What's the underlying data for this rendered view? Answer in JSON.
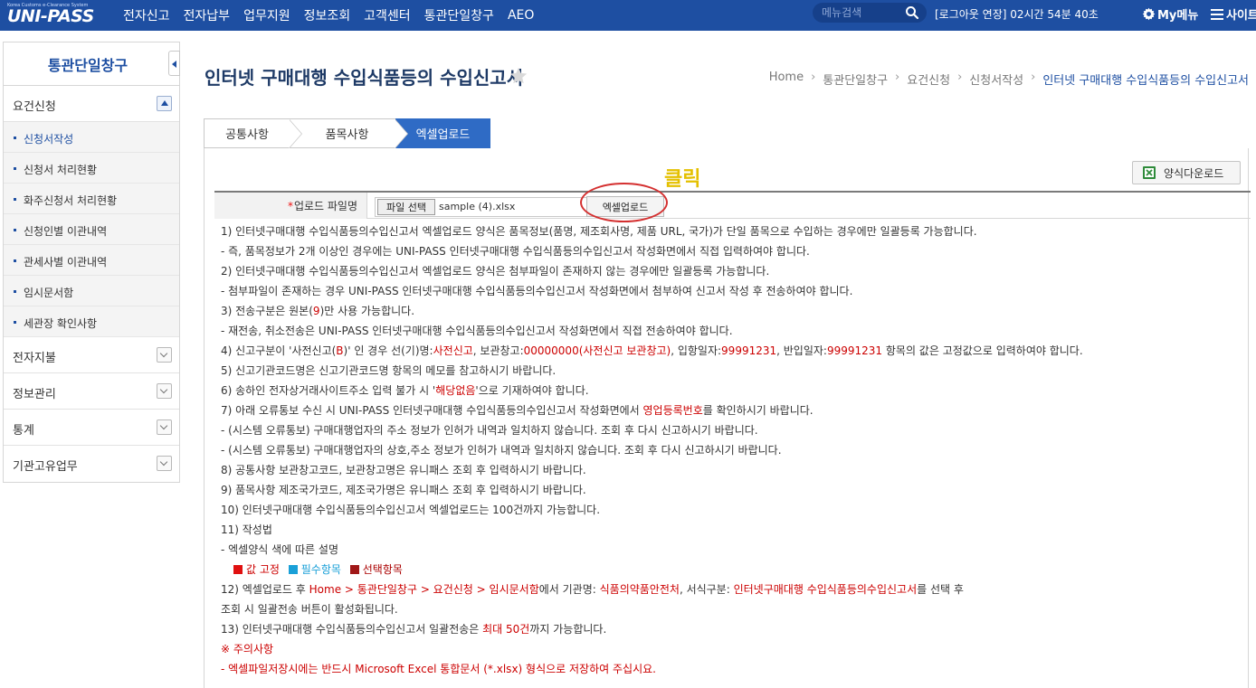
{
  "header": {
    "logo_subtitle": "Korea Customs e-Clearance System",
    "logo_text": "UNI-PASS",
    "nav": [
      "전자신고",
      "전자납부",
      "업무지원",
      "정보조회",
      "고객센터",
      "통관단일창구",
      "AEO"
    ],
    "search_placeholder": "메뉴검색",
    "session_text": "[로그아웃 연장] 02시간 54분 40초",
    "mymenu_label": "My메뉴",
    "sitemap_label": "사이트"
  },
  "sidebar": {
    "title": "통관단일창구",
    "group_open": "요건신청",
    "subitems": [
      "신청서작성",
      "신청서 처리현황",
      "화주신청서 처리현황",
      "신청인별 이관내역",
      "관세사별 이관내역",
      "임시문서함",
      "세관장 확인사항"
    ],
    "groups": [
      "전자지불",
      "정보관리",
      "통계",
      "기관고유업무"
    ]
  },
  "main": {
    "title": "인터넷 구매대행 수입식품등의 수입신고서",
    "breadcrumb": [
      "Home",
      "통관단일창구",
      "요건신청",
      "신청서작성",
      "인터넷 구매대행 수입식품등의 수입신고서"
    ],
    "tabs": [
      "공통사항",
      "품목사항",
      "엑셀업로드"
    ],
    "download_button": "양식다운로드",
    "upload_required_mark": "*",
    "upload_label": "업로드 파일명",
    "file_button": "파일 선택",
    "file_name": "sample (4).xlsx",
    "excel_upload_button": "엑셀업로드",
    "annotation_label": "클릭"
  },
  "instructions": {
    "l1": "1) 인터넷구매대행 수입식품등의수입신고서 엑셀업로드 양식은 품목정보(품명, 제조회사명, 제품 URL, 국가)가 단일 품목으로 수입하는 경우에만 일괄등록 가능합니다.",
    "l2": " - 즉, 품목정보가 2개 이상인 경우에는 UNI-PASS 인터넷구매대행 수입식품등의수입신고서 작성화면에서 직접 입력하여야 합니다.",
    "l3": "2) 인터넷구매대행 수입식품등의수입신고서 엑셀업로드 양식은 첨부파일이 존재하지 않는 경우에만 일괄등록 가능합니다.",
    "l4": " - 첨부파일이 존재하는 경우 UNI-PASS 인터넷구매대행 수입식품등의수입신고서 작성화면에서 첨부하여 신고서 작성 후 전송하여야 합니다.",
    "l5a": "3) 전송구분은 원본(",
    "l5b": "9",
    "l5c": ")만 사용 가능합니다.",
    "l6": " - 재전송, 취소전송은 UNI-PASS 인터넷구매대행 수입식품등의수입신고서 작성화면에서 직접 전송하여야 합니다.",
    "l7a": "4) 신고구분이 '사전신고(",
    "l7b": "B",
    "l7c": ")' 인 경우 선(기)명:",
    "l7d": "사전신고",
    "l7e": ", 보관창고:",
    "l7f": "00000000(사전신고 보관창고)",
    "l7g": ", 입항일자:",
    "l7h": "99991231",
    "l7i": ", 반입일자:",
    "l7j": "99991231",
    "l7k": " 항목의 값은 고정값으로 입력하여야 합니다.",
    "l8": "5) 신고기관코드명은 신고기관코드명 항목의 메모를 참고하시기 바랍니다.",
    "l9a": "6) 송하인 전자상거래사이트주소 입력 불가 시 '",
    "l9b": "해당없음",
    "l9c": "'으로 기재하여야 합니다.",
    "l10a": "7) 아래 오류통보 수신 시 UNI-PASS 인터넷구매대행 수입식품등의수입신고서 작성화면에서 ",
    "l10b": "영업등록번호",
    "l10c": "를 확인하시기 바랍니다.",
    "l11": " - (시스템 오류통보) 구매대행업자의 주소 정보가 인허가 내역과 일치하지 않습니다. 조회 후 다시 신고하시기 바랍니다.",
    "l12": " - (시스템 오류통보) 구매대행업자의 상호,주소 정보가 인허가 내역과 일치하지 않습니다. 조회 후 다시 신고하시기 바랍니다.",
    "l13": "8) 공통사항 보관창고코드, 보관창고명은 유니패스 조회 후 입력하시기 바랍니다.",
    "l14": "9) 품목사항 제조국가코드, 제조국가명은 유니패스 조회 후 입력하시기 바랍니다.",
    "l15": "10) 인터넷구매대행 수입식품등의수입신고서 엑셀업로드는 100건까지 가능합니다.",
    "l16": "11) 작성법",
    "l17": " - 엑셀양식 색에 따른 설명",
    "legend_fixed": "값 고정",
    "legend_required": "필수항목",
    "legend_optional": "선택항목",
    "l19a": "12) 엑셀업로드 후 ",
    "l19b": "Home > 통관단일창구 > 요건신청 > 임시문서함",
    "l19c": "에서 기관명: ",
    "l19d": "식품의약품안전처",
    "l19e": ", 서식구분: ",
    "l19f": "인터넷구매대행 수입식품등의수입신고서",
    "l19g": "를 선택 후",
    "l20": "  조회 시 일괄전송 버튼이 활성화됩니다.",
    "l21a": "13) 인터넷구매대행 수입식품등의수입신고서 일괄전송은 ",
    "l21b": "최대 50건",
    "l21c": "까지 가능합니다.",
    "l22": "※ 주의사항",
    "l23": " - 엑셀파일저장시에는 반드시 Microsoft Excel 통합문서 (*.xlsx) 형식으로 저장하여 주십시요."
  },
  "colors": {
    "header_bg": "#1e4fa2",
    "tab_active": "#2f6bc5",
    "legend_fixed": "#e01010",
    "legend_required": "#1aa0d8",
    "legend_optional": "#a01818",
    "annotation": "#d43030",
    "annotation_text": "#e4c000"
  }
}
